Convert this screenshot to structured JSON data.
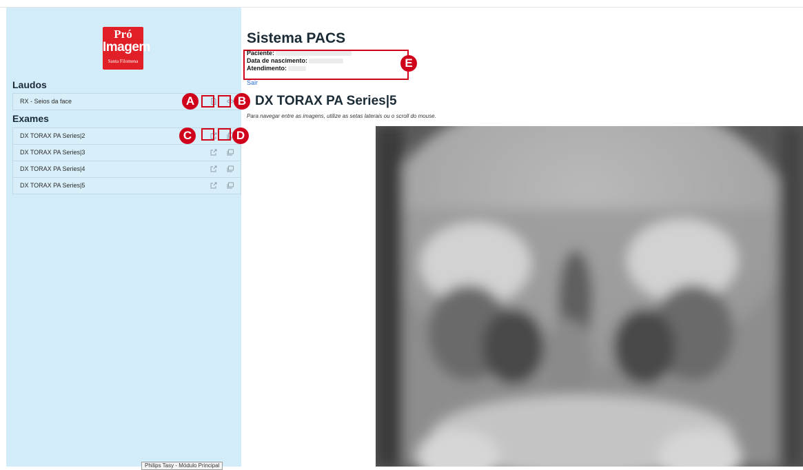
{
  "sidebar": {
    "logo": {
      "line1": "Pró",
      "line2": "Imagem",
      "line3": "Santa Filomena"
    },
    "laudos_title": "Laudos",
    "laudos": [
      {
        "label": "RX - Seios da face",
        "icons": [
          "document-icon",
          "eye-icon"
        ]
      }
    ],
    "exames_title": "Exames",
    "exames": [
      {
        "label": "DX TORAX PA Series|2"
      },
      {
        "label": "DX TORAX PA Series|3"
      },
      {
        "label": "DX TORAX PA Series|4"
      },
      {
        "label": "DX TORAX PA Series|5"
      }
    ],
    "exam_icons": [
      "external-link-icon",
      "images-icon"
    ],
    "tooltip": "Philips Tasy - Módulo Principal"
  },
  "main": {
    "title": "Sistema PACS",
    "patient": {
      "label_name": "Paciente:",
      "label_birth": "Data de nascimento:",
      "label_visit": "Atendimento:"
    },
    "logout": "Sair",
    "series_title": "DX TORAX PA Series|5",
    "hint": "Para navegar entre as imagens, utilize as setas laterais ou o scroll do mouse."
  },
  "annotations": {
    "a": "A",
    "b": "B",
    "c": "C",
    "d": "D",
    "e": "E"
  },
  "colors": {
    "sidebar_bg": "#d3ecf9",
    "accent_red": "#d0021b",
    "logo_red": "#e11f26",
    "link": "#2c6fd1"
  }
}
